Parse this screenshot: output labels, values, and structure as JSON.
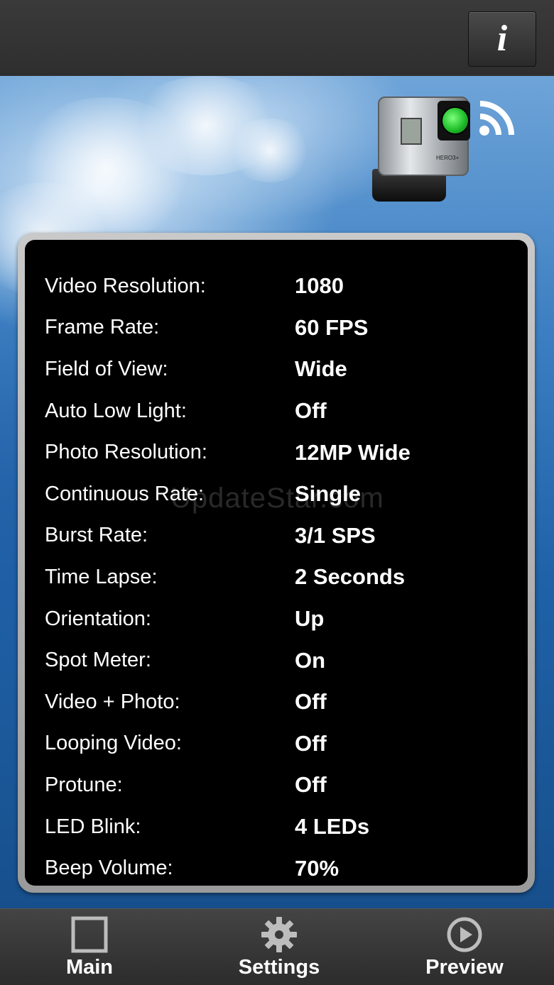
{
  "header": {
    "info_button_label": "i"
  },
  "camera": {
    "model_label": "HERO3+"
  },
  "settings": [
    {
      "label": "Video Resolution:",
      "value": "1080"
    },
    {
      "label": "Frame Rate:",
      "value": "60 FPS"
    },
    {
      "label": "Field of View:",
      "value": "Wide"
    },
    {
      "label": "Auto Low Light:",
      "value": "Off"
    },
    {
      "label": "Photo Resolution:",
      "value": "12MP Wide"
    },
    {
      "label": "Continuous Rate:",
      "value": "Single"
    },
    {
      "label": "Burst Rate:",
      "value": "3/1 SPS"
    },
    {
      "label": "Time Lapse:",
      "value": "2 Seconds"
    },
    {
      "label": "Orientation:",
      "value": "Up"
    },
    {
      "label": "Spot Meter:",
      "value": "On"
    },
    {
      "label": "Video + Photo:",
      "value": "Off"
    },
    {
      "label": "Looping Video:",
      "value": "Off"
    },
    {
      "label": "Protune:",
      "value": "Off"
    },
    {
      "label": "LED Blink:",
      "value": "4 LEDs"
    },
    {
      "label": "Beep Volume:",
      "value": "70%"
    }
  ],
  "watermark": "UpdateStar.com",
  "tabs": [
    {
      "label": "Main",
      "icon": "square-icon"
    },
    {
      "label": "Settings",
      "icon": "gear-icon"
    },
    {
      "label": "Preview",
      "icon": "play-icon"
    }
  ],
  "colors": {
    "lens_green": "#1fbf2a",
    "panel_bg": "#000000",
    "bar_bg": "#2e2e2e"
  }
}
